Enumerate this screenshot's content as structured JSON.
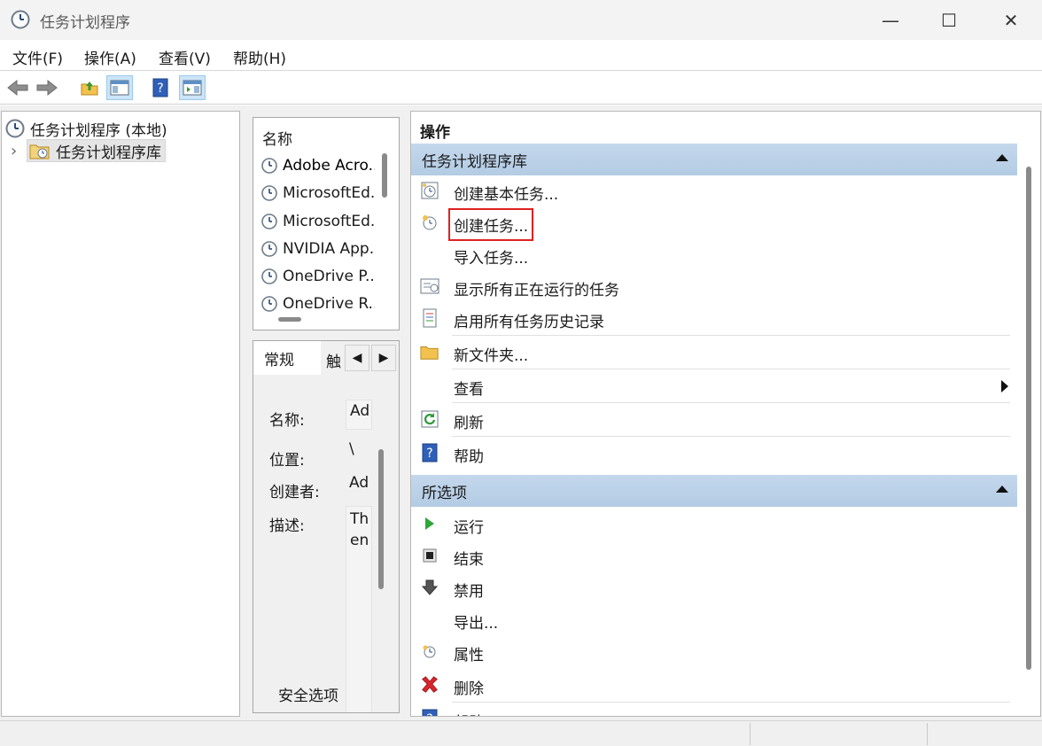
{
  "window": {
    "title": "任务计划程序",
    "min_glyph": "—",
    "max_glyph": "☐",
    "close_glyph": "✕"
  },
  "menu": {
    "items": [
      "文件(F)",
      "操作(A)",
      "查看(V)",
      "帮助(H)"
    ]
  },
  "toolbar": {
    "buttons": [
      "back-icon",
      "forward-icon",
      "folder-up-icon",
      "show-hide-console-tree-icon",
      "help-icon",
      "show-hide-action-pane-icon"
    ]
  },
  "tree": {
    "root_label": "任务计划程序 (本地)",
    "child_label": "任务计划程序库",
    "expand_glyph": "›"
  },
  "list": {
    "header": "名称",
    "rows": [
      "Adobe Acro...",
      "MicrosoftEd...",
      "MicrosoftEd...",
      "NVIDIA App...",
      "OneDrive P...",
      "OneDrive R..."
    ]
  },
  "detail": {
    "tab_general": "常规",
    "tab_trigger": "触",
    "left_arrow": "◀",
    "right_arrow": "▶",
    "name_label": "名称:",
    "name_value": "Ad",
    "location_label": "位置:",
    "location_value": "\\",
    "author_label": "创建者:",
    "author_value": "Ad",
    "desc_label": "描述:",
    "desc_value_1": "Th",
    "desc_value_2": "en",
    "security_label": "安全选项"
  },
  "actions": {
    "header": "操作",
    "section1": "任务计划程序库",
    "items1": [
      "创建基本任务...",
      "创建任务...",
      "导入任务...",
      "显示所有正在运行的任务",
      "启用所有任务历史记录",
      "新文件夹...",
      "查看",
      "刷新",
      "帮助"
    ],
    "section2": "所选项",
    "items2": [
      "运行",
      "结束",
      "禁用",
      "导出...",
      "属性",
      "删除",
      "帮助"
    ]
  }
}
